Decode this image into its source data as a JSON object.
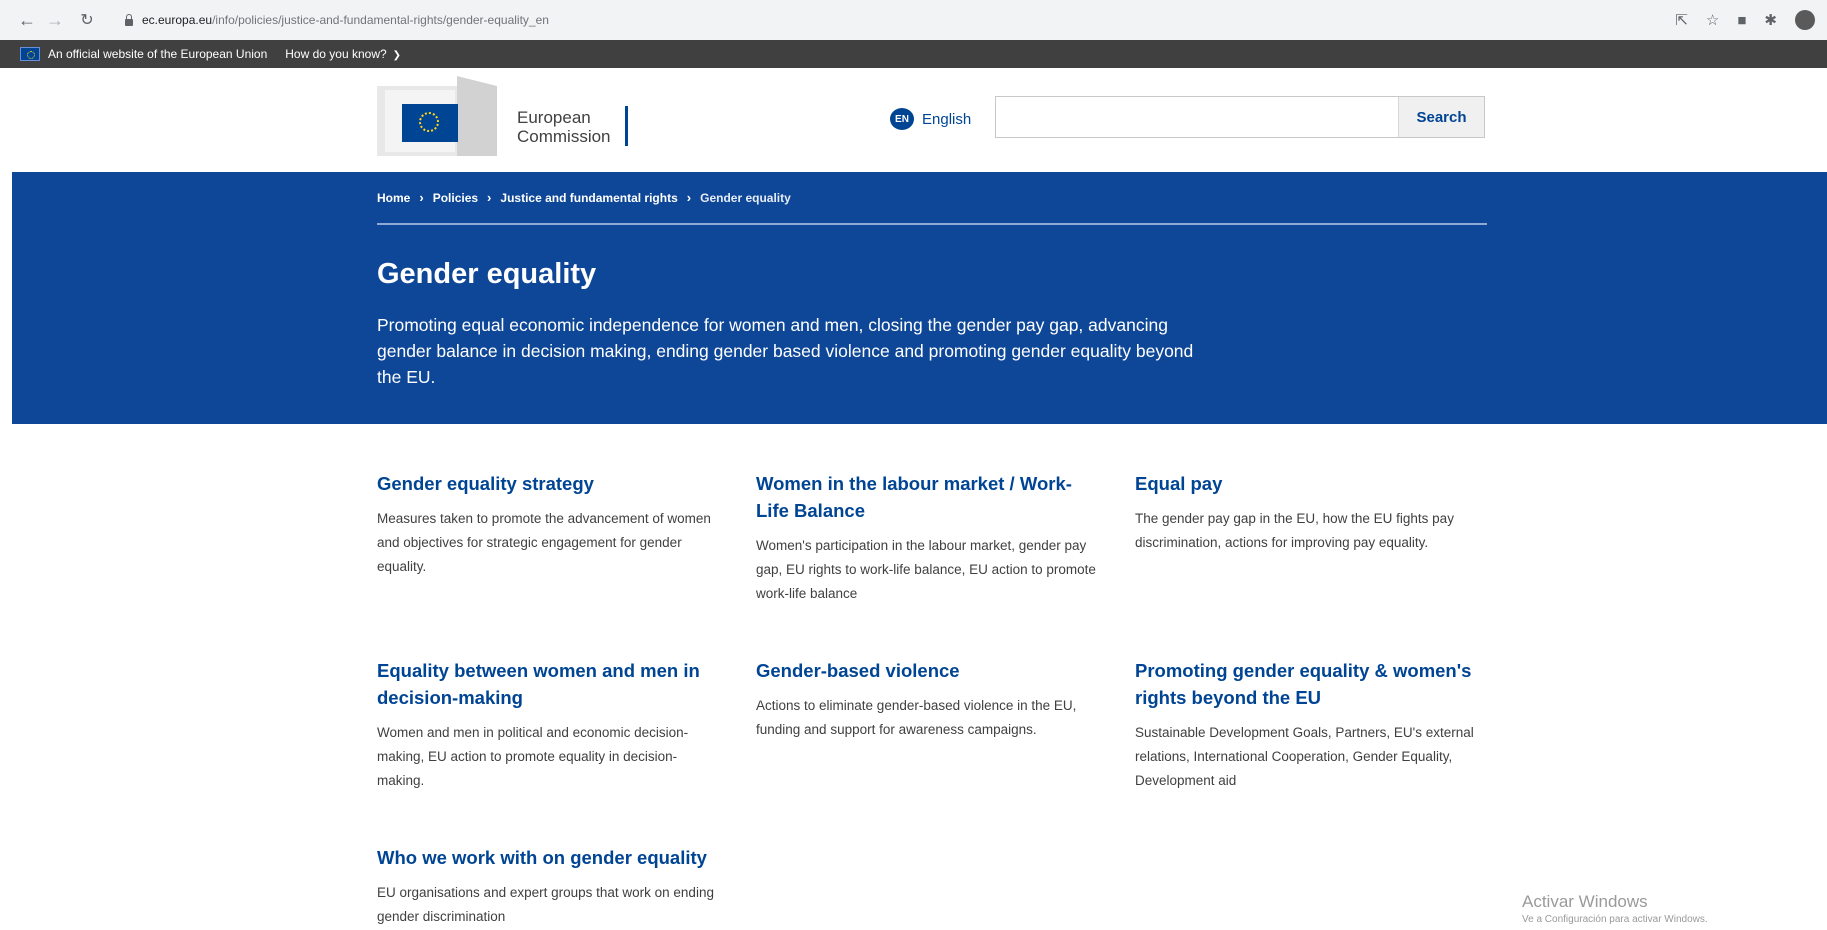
{
  "browser": {
    "url_domain": "ec.europa.eu",
    "url_path": "/info/policies/justice-and-fundamental-rights/gender-equality_en"
  },
  "eu_bar": {
    "official_text": "An official website of the European Union",
    "how_know": "How do you know?"
  },
  "header": {
    "logo_line1": "European",
    "logo_line2": "Commission",
    "language_code": "EN",
    "language": "English",
    "search_placeholder": "",
    "search_button": "Search"
  },
  "breadcrumb": {
    "items": [
      "Home",
      "Policies",
      "Justice and fundamental rights"
    ],
    "current": "Gender equality"
  },
  "page": {
    "title": "Gender equality",
    "lead": "Promoting equal economic independence for women and men, closing the gender pay gap, advancing gender balance in decision making, ending gender based violence and promoting gender equality beyond the EU."
  },
  "cards": [
    {
      "title": "Gender equality strategy",
      "description": "Measures taken to promote the advancement of women and objectives for strategic engagement for gender equality."
    },
    {
      "title": "Women in the labour market / Work-Life Balance",
      "description": "Women's participation in the labour market, gender pay gap, EU rights to work-life balance, EU action to promote work-life balance"
    },
    {
      "title": "Equal pay",
      "description": "The gender pay gap in the EU, how the EU fights pay discrimination, actions for improving pay equality."
    },
    {
      "title": "Equality between women and men in decision-making",
      "description": "Women and men in political and economic decision-making, EU action to promote equality in decision-making."
    },
    {
      "title": "Gender-based violence",
      "description": "Actions to eliminate gender-based violence in the EU, funding and support for awareness campaigns."
    },
    {
      "title": "Promoting gender equality & women's rights beyond the EU",
      "description": "Sustainable Development Goals, Partners, EU's external relations, International Cooperation, Gender Equality, Development aid"
    },
    {
      "title": "Who we work with on gender equality",
      "description": "EU organisations and expert groups that work on ending gender discrimination"
    }
  ],
  "watermark": {
    "line1": "Activar Windows",
    "line2": "Ve a Configuración para activar Windows."
  }
}
